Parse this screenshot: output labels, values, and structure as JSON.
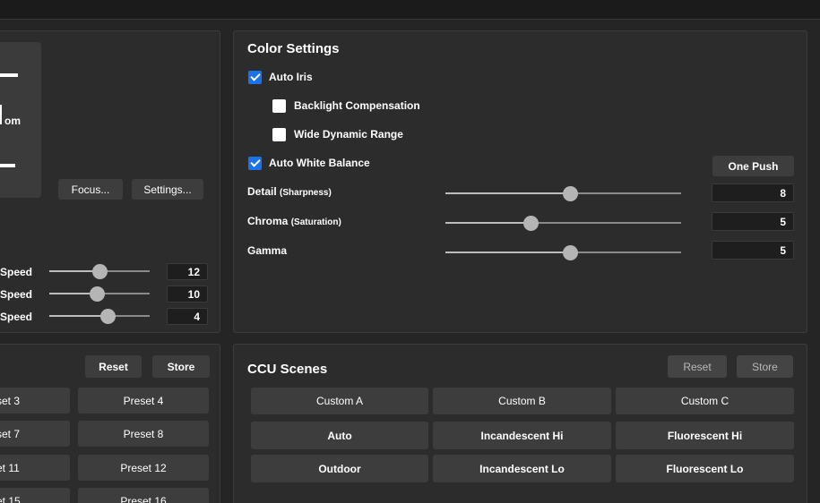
{
  "camera": {
    "zoom_label": "om",
    "focus_button": "Focus...",
    "settings_button": "Settings...",
    "speeds": [
      {
        "label": "Speed",
        "value": "12",
        "level": 0.5
      },
      {
        "label": "Speed",
        "value": "10",
        "level": 0.47
      },
      {
        "label": "Speed",
        "value": "4",
        "level": 0.58
      }
    ]
  },
  "color_settings": {
    "title": "Color Settings",
    "auto_iris": {
      "label": "Auto Iris",
      "checked": true
    },
    "backlight": {
      "label": "Backlight Compensation",
      "checked": false
    },
    "wdr": {
      "label": "Wide Dynamic Range",
      "checked": false
    },
    "awb": {
      "label": "Auto White Balance",
      "checked": true
    },
    "one_push": "One Push",
    "detail": {
      "label": "Detail",
      "sub": "(Sharpness)",
      "value": "8",
      "level": 0.53
    },
    "chroma": {
      "label": "Chroma",
      "sub": "(Saturation)",
      "value": "5",
      "level": 0.36
    },
    "gamma": {
      "label": "Gamma",
      "value": "5",
      "level": 0.53
    }
  },
  "presets": {
    "reset": "Reset",
    "store": "Store",
    "left_col": [
      "set 3",
      "set 7",
      "et 11",
      "et 15"
    ],
    "right_col": [
      "Preset 4",
      "Preset 8",
      "Preset 12",
      "Preset 16"
    ]
  },
  "ccu": {
    "title": "CCU Scenes",
    "reset": "Reset",
    "store": "Store",
    "custom": [
      "Custom A",
      "Custom B",
      "Custom C"
    ],
    "row1": [
      "Auto",
      "Incandescent Hi",
      "Fluorescent Hi"
    ],
    "row2": [
      "Outdoor",
      "Incandescent Lo",
      "Fluorescent Lo"
    ]
  }
}
